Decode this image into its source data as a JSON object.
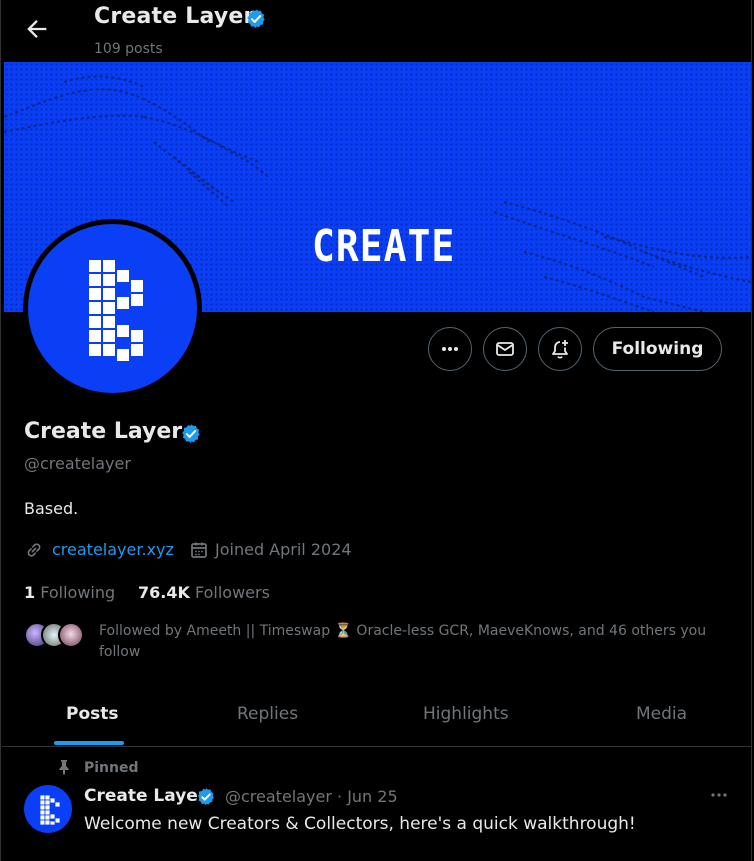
{
  "header": {
    "title": "Create Layer",
    "post_count": "109 posts"
  },
  "banner": {
    "word": "CREATE"
  },
  "actions": {
    "follow_label": "Following"
  },
  "profile": {
    "name": "Create Layer",
    "handle": "@createlayer",
    "bio": "Based.",
    "website": "createlayer.xyz",
    "joined": "Joined April 2024",
    "following_count": "1",
    "following_label": "Following",
    "followers_count": "76.4K",
    "followers_label": "Followers",
    "followed_by": "Followed by Ameeth || Timeswap ⏳ Oracle-less GCR, MaeveKnows, and 46 others you follow"
  },
  "tabs": [
    {
      "label": "Posts",
      "active": true
    },
    {
      "label": "Replies",
      "active": false
    },
    {
      "label": "Highlights",
      "active": false
    },
    {
      "label": "Media",
      "active": false
    }
  ],
  "pinned_post": {
    "pinned_label": "Pinned",
    "author_name": "Create Layer",
    "author_handle_date": "@createlayer · Jun 25",
    "text": "Welcome new Creators & Collectors, here's a quick walkthrough!"
  },
  "colors": {
    "background": "#000000",
    "brand_blue": "#0b3ff5",
    "link_blue": "#1d9bf0",
    "secondary_text": "#71767b"
  },
  "icons": [
    "back-arrow-icon",
    "verified-badge-icon",
    "more-icon",
    "mail-icon",
    "bell-plus-icon",
    "link-icon",
    "calendar-icon",
    "pin-icon"
  ]
}
